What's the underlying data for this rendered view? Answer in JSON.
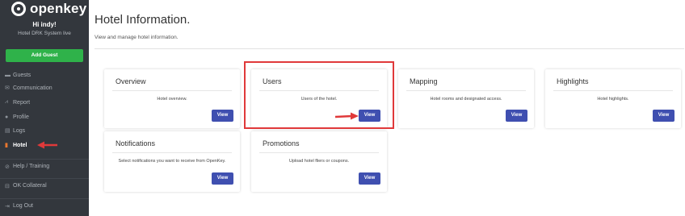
{
  "brand": {
    "logo_text": "openkey"
  },
  "sidebar": {
    "greeting": "Hi indy!",
    "system_name": "Hotel DRK System live",
    "add_guest_label": "Add Guest",
    "items": [
      {
        "label": "Guests",
        "icon": "bed-icon"
      },
      {
        "label": "Communication",
        "icon": "envelope-icon"
      },
      {
        "label": "Report",
        "icon": "chart-icon"
      },
      {
        "label": "Profile",
        "icon": "user-icon"
      },
      {
        "label": "Logs",
        "icon": "list-icon"
      },
      {
        "label": "Hotel",
        "icon": "building-icon",
        "active": true
      },
      {
        "label": "Help / Training",
        "icon": "help-icon"
      },
      {
        "label": "OK Collateral",
        "icon": "cart-icon"
      },
      {
        "label": "Log Out",
        "icon": "logout-icon"
      }
    ]
  },
  "page": {
    "title": "Hotel Information.",
    "subtitle": "View and manage hotel information."
  },
  "cards": [
    {
      "title": "Overview",
      "description": "Hotel overview.",
      "button": "View"
    },
    {
      "title": "Users",
      "description": "Users of the hotel.",
      "button": "View"
    },
    {
      "title": "Mapping",
      "description": "Hotel rooms and designated access.",
      "button": "View"
    },
    {
      "title": "Highlights",
      "description": "Hotel highlights.",
      "button": "View"
    },
    {
      "title": "Notifications",
      "description": "Select notifications you want to receive from OpenKey.",
      "button": "View"
    },
    {
      "title": "Promotions",
      "description": "Upload hotel fliers or coupons.",
      "button": "View"
    }
  ],
  "colors": {
    "sidebar_bg": "#33373d",
    "add_guest_green": "#2fb24a",
    "view_button_blue": "#3f4fb0",
    "highlight_red": "#e0393a",
    "active_icon_orange": "#e8772e"
  }
}
